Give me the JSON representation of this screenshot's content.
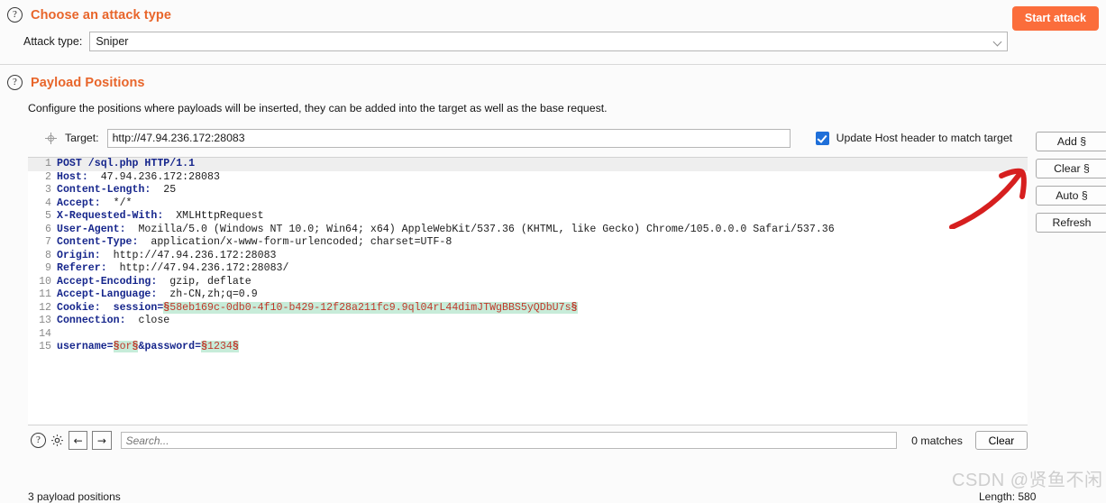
{
  "attack_section": {
    "help_icon": "question-mark-icon",
    "title": "Choose an attack type",
    "start_button": "Start attack",
    "attack_type_label": "Attack type:",
    "attack_type_value": "Sniper",
    "dropdown_icon": "chevron-down-icon"
  },
  "payload_section": {
    "help_icon": "question-mark-icon",
    "title": "Payload Positions",
    "description": "Configure the positions where payloads will be inserted, they can be added into the target as well as the base request.",
    "target_icon": "crosshair-icon",
    "target_label": "Target:",
    "target_value": "http://47.94.236.172:28083",
    "update_host_checkbox_label": "Update Host header to match target",
    "update_host_checked": true,
    "side_buttons": [
      {
        "label": "Add §",
        "name": "add-payload-position-button"
      },
      {
        "label": "Clear §",
        "name": "clear-payload-positions-button"
      },
      {
        "label": "Auto §",
        "name": "auto-payload-positions-button"
      },
      {
        "label": "Refresh",
        "name": "refresh-button"
      }
    ],
    "position_count": "3 payload positions",
    "length": "Length: 580"
  },
  "request": {
    "lines": [
      {
        "n": "1",
        "current": true,
        "parts": [
          {
            "t": "POST /sql.php HTTP/1.1",
            "s": "hdr"
          }
        ]
      },
      {
        "n": "2",
        "current": false,
        "parts": [
          {
            "t": "Host:",
            "s": "hdr"
          },
          {
            "t": "  47.94.236.172:28083",
            "s": "val"
          }
        ]
      },
      {
        "n": "3",
        "current": false,
        "parts": [
          {
            "t": "Content-Length:",
            "s": "hdr"
          },
          {
            "t": "  25",
            "s": "val"
          }
        ]
      },
      {
        "n": "4",
        "current": false,
        "parts": [
          {
            "t": "Accept:",
            "s": "hdr"
          },
          {
            "t": "  */*",
            "s": "val"
          }
        ]
      },
      {
        "n": "5",
        "current": false,
        "parts": [
          {
            "t": "X-Requested-With:",
            "s": "hdr"
          },
          {
            "t": "  XMLHttpRequest",
            "s": "val"
          }
        ]
      },
      {
        "n": "6",
        "current": false,
        "parts": [
          {
            "t": "User-Agent:",
            "s": "hdr"
          },
          {
            "t": "  Mozilla/5.0 (Windows NT 10.0; Win64; x64) AppleWebKit/537.36 (KHTML, like Gecko) Chrome/105.0.0.0 Safari/537.36",
            "s": "val"
          }
        ]
      },
      {
        "n": "7",
        "current": false,
        "parts": [
          {
            "t": "Content-Type:",
            "s": "hdr"
          },
          {
            "t": "  application/x-www-form-urlencoded; charset=UTF-8",
            "s": "val"
          }
        ]
      },
      {
        "n": "8",
        "current": false,
        "parts": [
          {
            "t": "Origin:",
            "s": "hdr"
          },
          {
            "t": "  http://47.94.236.172:28083",
            "s": "val"
          }
        ]
      },
      {
        "n": "9",
        "current": false,
        "parts": [
          {
            "t": "Referer:",
            "s": "hdr"
          },
          {
            "t": "  http://47.94.236.172:28083/",
            "s": "val"
          }
        ]
      },
      {
        "n": "10",
        "current": false,
        "parts": [
          {
            "t": "Accept-Encoding:",
            "s": "hdr"
          },
          {
            "t": "  gzip, deflate",
            "s": "val"
          }
        ]
      },
      {
        "n": "11",
        "current": false,
        "parts": [
          {
            "t": "Accept-Language:",
            "s": "hdr"
          },
          {
            "t": "  zh-CN,zh;q=0.9",
            "s": "val"
          }
        ]
      },
      {
        "n": "12",
        "current": false,
        "parts": [
          {
            "t": "Cookie:",
            "s": "hdr"
          },
          {
            "t": "  session=",
            "s": "hdr"
          },
          {
            "t": "§",
            "s": "mark"
          },
          {
            "t": "58eb169c-0db0-4f10-b429-12f28a211fc9.9ql04rL44dimJTWgBBS5yQDbU7s",
            "s": "marktxt"
          },
          {
            "t": "§",
            "s": "mark"
          }
        ]
      },
      {
        "n": "13",
        "current": false,
        "parts": [
          {
            "t": "Connection:",
            "s": "hdr"
          },
          {
            "t": "  close",
            "s": "val"
          }
        ]
      },
      {
        "n": "14",
        "current": false,
        "parts": [
          {
            "t": "",
            "s": "val"
          }
        ]
      },
      {
        "n": "15",
        "current": false,
        "parts": [
          {
            "t": "username=",
            "s": "hdr"
          },
          {
            "t": "§",
            "s": "mark"
          },
          {
            "t": "or",
            "s": "marktxt"
          },
          {
            "t": "§",
            "s": "mark"
          },
          {
            "t": "&password=",
            "s": "hdr"
          },
          {
            "t": "§",
            "s": "mark"
          },
          {
            "t": "1234",
            "s": "marktxt"
          },
          {
            "t": "§",
            "s": "mark"
          }
        ]
      }
    ]
  },
  "search_bar": {
    "help_icon": "question-mark-icon",
    "settings_icon": "gear-icon",
    "prev_icon": "arrow-left-icon",
    "next_icon": "arrow-right-icon",
    "placeholder": "Search...",
    "value": "",
    "matches": "0 matches",
    "clear_label": "Clear"
  },
  "annotation": {
    "arrow": "red-curved-arrow",
    "color": "#d61f1f"
  },
  "watermark": "CSDN @贤鱼不闲",
  "colors": {
    "accent": "#e8652a",
    "button": "#fb6d3b",
    "header_blue": "#16268c",
    "marker_green": "#c7ecd9",
    "marker_red": "#c0392b",
    "checkbox_blue": "#1e6fd9"
  }
}
